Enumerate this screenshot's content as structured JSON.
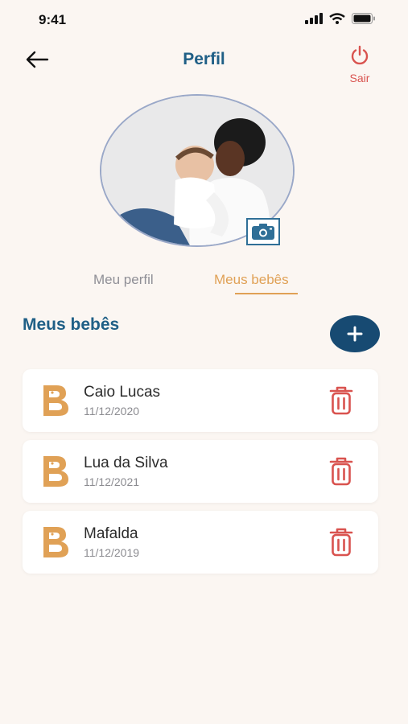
{
  "status_bar": {
    "time": "9:41"
  },
  "header": {
    "title": "Perfil",
    "logout_label": "Sair"
  },
  "tabs": [
    {
      "label": "Meu perfil",
      "active": false
    },
    {
      "label": "Meus bebês",
      "active": true
    }
  ],
  "section": {
    "title": "Meus bebês"
  },
  "babies": [
    {
      "name": "Caio Lucas",
      "birth_date": "11/12/2020"
    },
    {
      "name": "Lua da Silva",
      "birth_date": "11/12/2021"
    },
    {
      "name": "Mafalda",
      "birth_date": "11/12/2019"
    }
  ],
  "colors": {
    "primary": "#1f5f86",
    "accent": "#e0a156",
    "danger": "#d9534f",
    "add_button": "#174a72",
    "background": "#fbf6f2"
  },
  "icons": [
    "signal-icon",
    "wifi-icon",
    "battery-icon",
    "back-arrow-icon",
    "power-icon",
    "camera-icon",
    "plus-icon",
    "baby-logo-icon",
    "trash-icon"
  ]
}
